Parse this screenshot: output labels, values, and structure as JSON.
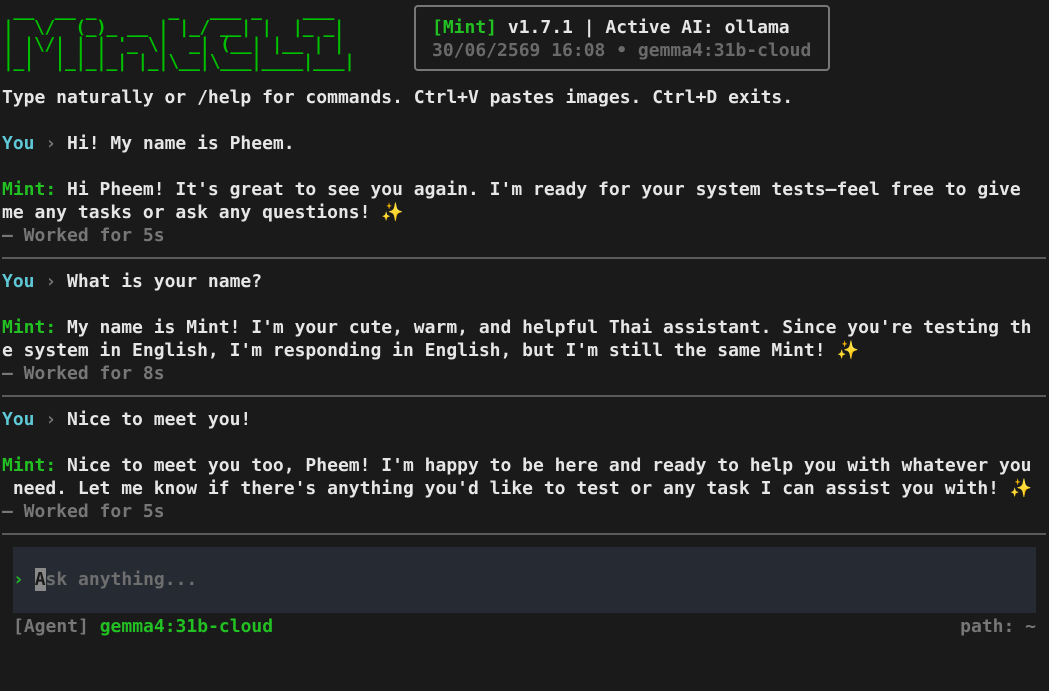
{
  "logo": {
    "art": " __  __ _       _   ___ _    ___ \n|  \\/  (_)_ __ | |_/ __| |  |_ _|\n| |\\/| | | '_ \\|  _| (__| |__ | | \n|_|  |_|_|_| |_|\\__|\\___|____|___|"
  },
  "header": {
    "app_tag": "[Mint]",
    "version_info": " v1.7.1 | Active AI: ollama",
    "timestamp": "30/06/2569 16:08",
    "bullet": " • ",
    "model": "gemma4:31b-cloud"
  },
  "intro_text": "Type naturally or /help for commands. Ctrl+V pastes images. Ctrl+D exits.",
  "conversation": [
    {
      "user_label": "You",
      "arrow": " › ",
      "user_message": "Hi! My name is Pheem.",
      "assistant_label": "Mint:",
      "assistant_line1": " Hi Pheem! It's great to see you again. I'm ready for your system tests—feel free to give",
      "assistant_line2": "me any tasks or ask any questions! ✨",
      "worked": "— Worked for 5s"
    },
    {
      "user_label": "You",
      "arrow": " › ",
      "user_message": "What is your name?",
      "assistant_label": "Mint:",
      "assistant_line1": " My name is Mint! I'm your cute, warm, and helpful Thai assistant. Since you're testing th",
      "assistant_line2": "e system in English, I'm responding in English, but I'm still the same Mint! ✨",
      "worked": "— Worked for 8s"
    },
    {
      "user_label": "You",
      "arrow": " › ",
      "user_message": "Nice to meet you!",
      "assistant_label": "Mint:",
      "assistant_line1": " Nice to meet you too, Pheem! I'm happy to be here and ready to help you with whatever you",
      "assistant_line2": " need. Let me know if there's anything you'd like to test or any task I can assist you with! ✨",
      "worked": "— Worked for 5s"
    }
  ],
  "input": {
    "prompt": "› ",
    "cursor_char": "A",
    "placeholder_rest": "sk anything..."
  },
  "status": {
    "mode": "[Agent]",
    "model": "gemma4:31b-cloud",
    "path": "path: ~"
  },
  "colors": {
    "background": "#1a1a1a",
    "accent_green": "#22c022",
    "user_cyan": "#5fc8d6",
    "dim_gray": "#777777",
    "input_bg": "#262a33"
  }
}
